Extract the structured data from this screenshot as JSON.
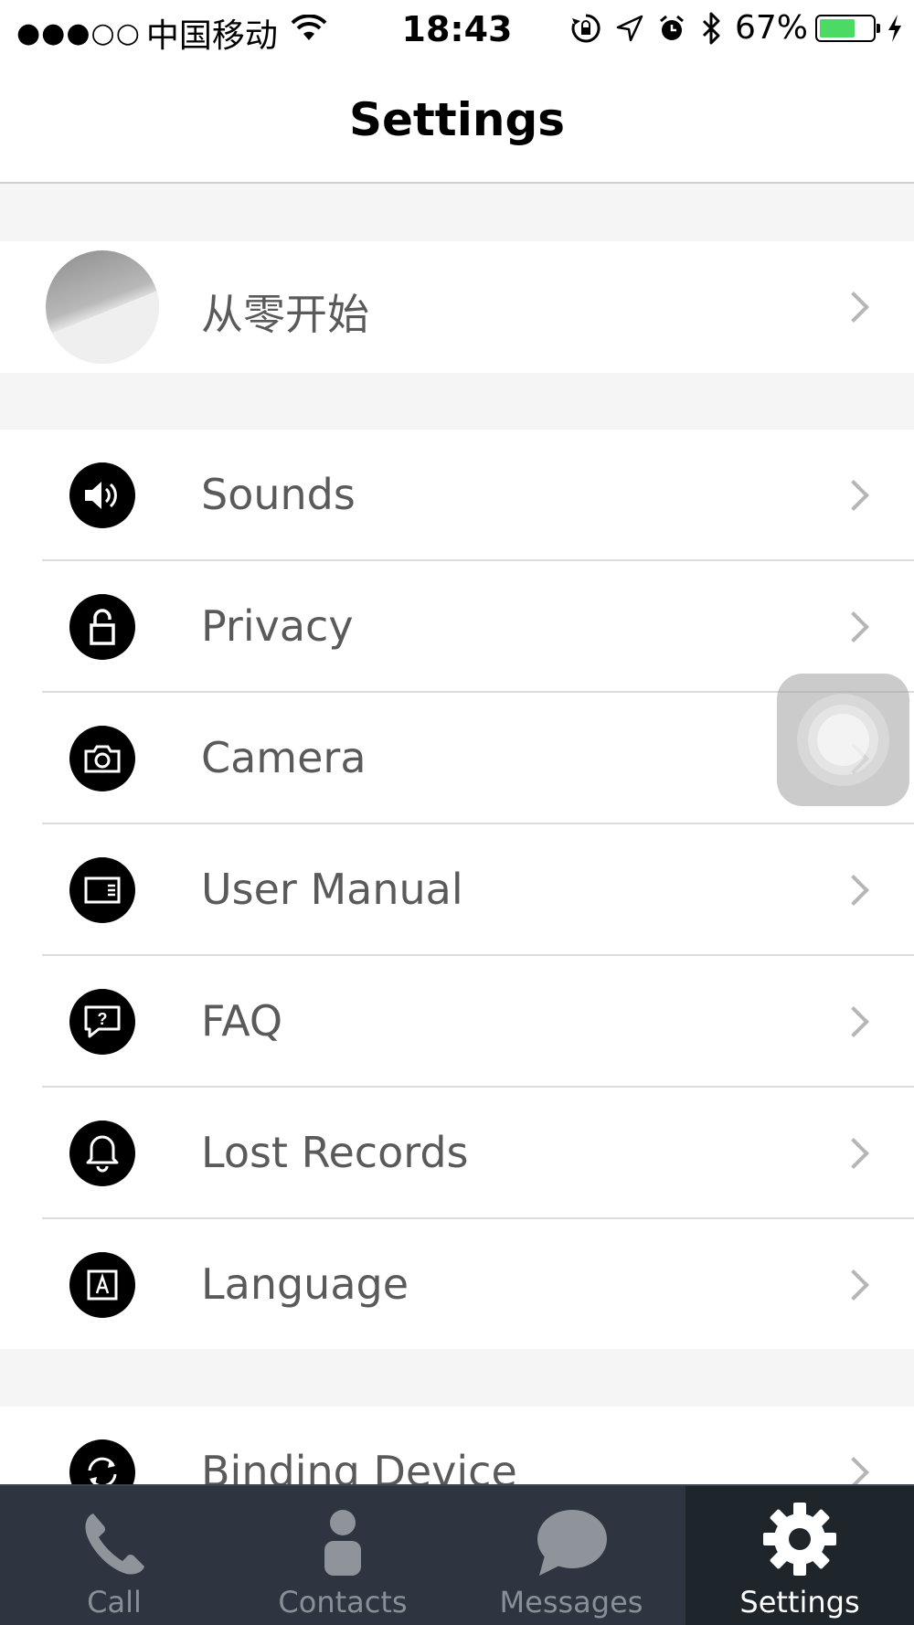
{
  "status_bar": {
    "signal_dots": "●●●○○",
    "carrier": "中国移动",
    "time": "18:43",
    "battery_percent": "67%",
    "battery_level": 0.67,
    "battery_color": "#4cd964"
  },
  "nav": {
    "title": "Settings"
  },
  "profile": {
    "name": "从零开始"
  },
  "menu": {
    "items": [
      {
        "label": "Sounds",
        "icon": "speaker-icon"
      },
      {
        "label": "Privacy",
        "icon": "lock-icon"
      },
      {
        "label": "Camera",
        "icon": "camera-icon"
      },
      {
        "label": "User Manual",
        "icon": "manual-icon"
      },
      {
        "label": "FAQ",
        "icon": "question-bubble-icon"
      },
      {
        "label": "Lost Records",
        "icon": "bell-icon"
      },
      {
        "label": "Language",
        "icon": "language-icon"
      }
    ]
  },
  "binding": {
    "label": "Binding Device"
  },
  "tab_bar": {
    "tabs": [
      {
        "label": "Call",
        "icon": "phone-icon",
        "active": false
      },
      {
        "label": "Contacts",
        "icon": "person-icon",
        "active": false
      },
      {
        "label": "Messages",
        "icon": "chat-bubble-icon",
        "active": false
      },
      {
        "label": "Settings",
        "icon": "gear-icon",
        "active": true
      }
    ]
  },
  "colors": {
    "tab_bar_bg": "#2e3440",
    "tab_active_bg": "#1e252b",
    "label_text": "#5a5a5a"
  }
}
